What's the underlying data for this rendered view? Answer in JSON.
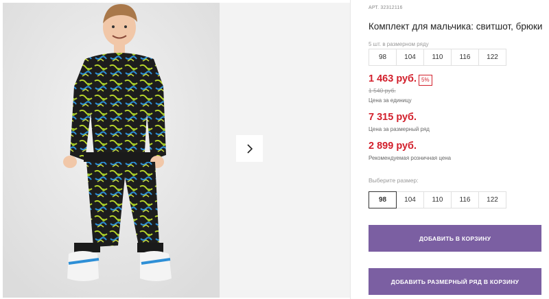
{
  "gallery": {
    "next_icon": "chevron-right-icon"
  },
  "product": {
    "article": "АРТ. 32312116",
    "title": "Комплект для мальчика: свитшот, брюки",
    "pack_info": "5 шт. в размерном ряду",
    "pack_sizes": [
      "98",
      "104",
      "110",
      "116",
      "122"
    ],
    "price": "1 463 руб.",
    "discount": "5%",
    "old_price": "1 540 руб.",
    "price_note": "Цена за единицу",
    "row_price": "7 315 руб.",
    "row_price_note": "Цена за размерный ряд",
    "retail_price": "2 899 руб.",
    "retail_price_note": "Рекомендуемая розничная цена",
    "choose_size_label": "Выберите размер:",
    "size_options": [
      "98",
      "104",
      "110",
      "116",
      "122"
    ],
    "selected_size": "98"
  },
  "actions": {
    "add_to_cart": "ДОБАВИТЬ В КОРЗИНУ",
    "add_row_to_cart": "ДОБАВИТЬ РАЗМЕРНЫЙ РЯД В КОРЗИНУ"
  },
  "colors": {
    "accent": "#7b5fa2",
    "price": "#d21f2b"
  }
}
